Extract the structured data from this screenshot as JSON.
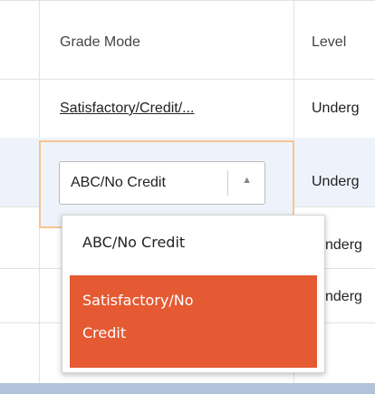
{
  "table": {
    "headers": {
      "grade_mode": "Grade Mode",
      "level": "Level"
    },
    "rows": [
      {
        "grade_mode": "Satisfactory/Credit/...",
        "level": "Underg"
      },
      {
        "grade_mode": "ABC/No Credit",
        "level": "Underg"
      },
      {
        "grade_mode": "",
        "level": "nderg"
      },
      {
        "grade_mode": "",
        "level": "nderg"
      }
    ]
  },
  "dropdown": {
    "selected": "ABC/No Credit",
    "options": [
      {
        "label": "ABC/No Credit"
      },
      {
        "label_line1": "Satisfactory/No",
        "label_line2": "Credit"
      }
    ]
  },
  "colors": {
    "highlight_option": "#e55a33",
    "focus_border": "#f7c48f",
    "row_highlight": "#eef3fb"
  }
}
